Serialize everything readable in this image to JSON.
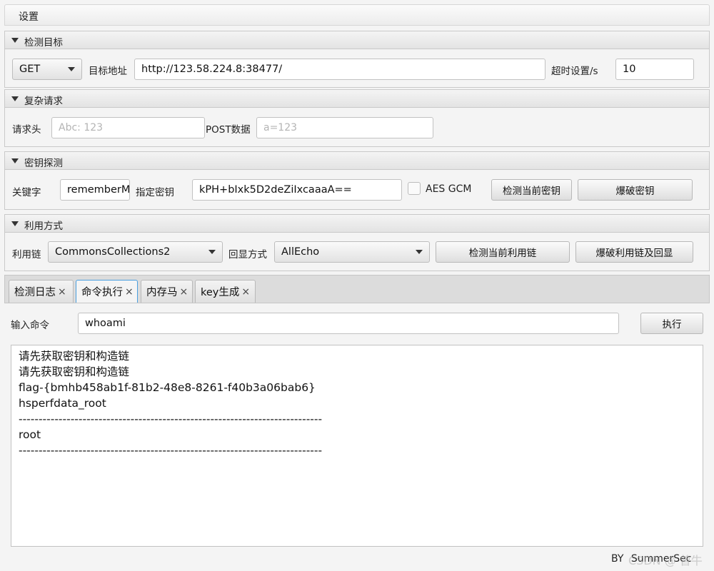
{
  "menu": {
    "settings": "设置"
  },
  "target_pane": {
    "title": "检测目标",
    "method": "GET",
    "url_label": "目标地址",
    "url_value": "http://123.58.224.8:38477/",
    "timeout_label": "超时设置/s",
    "timeout_value": "10"
  },
  "complex_pane": {
    "title": "复杂请求",
    "header_label": "请求头",
    "header_placeholder": "Abc: 123",
    "post_label": "POST数据",
    "post_placeholder": "a=123"
  },
  "key_pane": {
    "title": "密钥探测",
    "keyword_label": "关键字",
    "keyword_value": "rememberMe",
    "key_label": "指定密钥",
    "key_value": "kPH+bIxk5D2deZiIxcaaaA==",
    "aes_gcm_label": "AES GCM",
    "check_key_btn": "检测当前密钥",
    "brute_key_btn": "爆破密钥"
  },
  "exploit_pane": {
    "title": "利用方式",
    "chain_label": "利用链",
    "chain_value": "CommonsCollections2",
    "echo_label": "回显方式",
    "echo_value": "AllEcho",
    "check_chain_btn": "检测当前利用链",
    "brute_chain_btn": "爆破利用链及回显"
  },
  "tabs": [
    {
      "label": "检测日志",
      "close": "×"
    },
    {
      "label": "命令执行",
      "close": "×"
    },
    {
      "label": "内存马",
      "close": "×"
    },
    {
      "label": "key生成",
      "close": "×"
    }
  ],
  "command": {
    "label": "输入命令",
    "value": "whoami",
    "exec_btn": "执行"
  },
  "output_lines": [
    "请先获取密钥和构造链",
    "请先获取密钥和构造链",
    "flag-{bmhb458ab1f-81b2-48e8-8261-f40b3a06bab6}",
    "hsperfdata_root",
    "----------------------------------------------------------------------------",
    "root",
    "----------------------------------------------------------------------------"
  ],
  "footer": {
    "by": "BY",
    "author": "SummerSec"
  },
  "watermark": "CSDN @ 曾牛"
}
